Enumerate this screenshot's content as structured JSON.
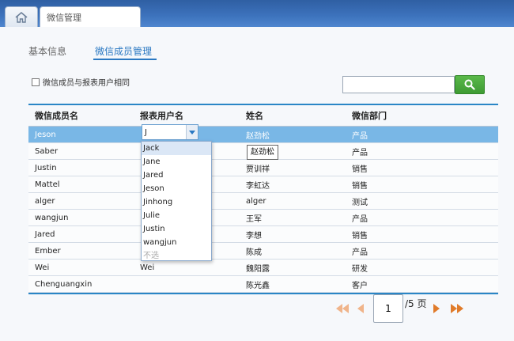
{
  "window": {
    "tab_title": "微信管理"
  },
  "subtabs": [
    {
      "label": "基本信息"
    },
    {
      "label": "微信成员管理"
    }
  ],
  "filter": {
    "checkbox_label": "微信成员与报表用户相同"
  },
  "search": {
    "value": "",
    "placeholder": ""
  },
  "table": {
    "headers": [
      "微信成员名",
      "报表用户名",
      "姓名",
      "微信部门"
    ],
    "rows": [
      [
        "Jeson",
        "J",
        "赵劲松",
        "产品"
      ],
      [
        "Saber",
        "",
        "",
        "产品"
      ],
      [
        "Justin",
        "",
        "贾训祥",
        "销售"
      ],
      [
        "Mattel",
        "",
        "李虹达",
        "销售"
      ],
      [
        "alger",
        "",
        "alger",
        "测试"
      ],
      [
        "wangjun",
        "",
        "王军",
        "产品"
      ],
      [
        "Jared",
        "",
        "李想",
        "销售"
      ],
      [
        "Ember",
        "",
        "陈成",
        "产品"
      ],
      [
        "Wei",
        "Wei",
        "魏阳露",
        "研发"
      ],
      [
        "Chenguangxin",
        "",
        "陈光鑫",
        "客户"
      ]
    ]
  },
  "dropdown": {
    "items": [
      "Jack",
      "Jane",
      "Jared",
      "Jeson",
      "Jinhong",
      "Julie",
      "Justin",
      "wangjun"
    ],
    "disabled_item": "不选"
  },
  "tooltip": {
    "text": "赵劲松"
  },
  "pager": {
    "current": "1",
    "total_label": "/5 页"
  },
  "colors": {
    "accent": "#2a86c6",
    "selected_row": "#79b7e6",
    "search_button": "#48a83d",
    "pager_arrow": "#e07b2a"
  }
}
